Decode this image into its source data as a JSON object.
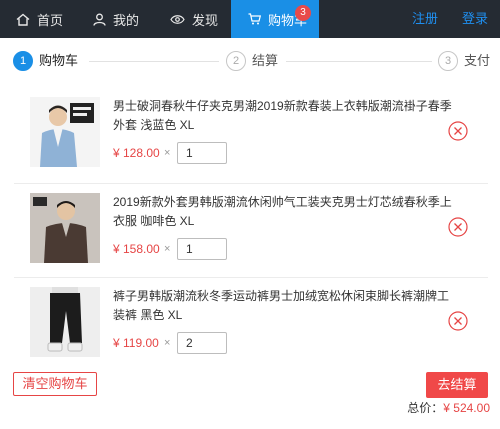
{
  "nav": {
    "home": "首页",
    "mine": "我的",
    "discover": "发现",
    "cart": "购物车",
    "cart_count": "3",
    "register": "注册",
    "login": "登录",
    "accent": "#1a8fe6",
    "bg": "#252b33"
  },
  "steps": [
    {
      "num": "1",
      "label": "购物车",
      "active": true
    },
    {
      "num": "2",
      "label": "结算",
      "active": false
    },
    {
      "num": "3",
      "label": "支付",
      "active": false
    }
  ],
  "items": [
    {
      "title": "男士破洞春秋牛仔夹克男潮2019新款春装上衣韩版潮流褂子春季外套 浅蓝色 XL",
      "price": "¥ 128.00",
      "times": "×",
      "qty": "1",
      "image": "denim-jacket-photo"
    },
    {
      "title": "2019新款外套男韩版潮流休闲帅气工装夹克男士灯芯绒春秋季上衣服 咖啡色 XL",
      "price": "¥ 158.00",
      "times": "×",
      "qty": "1",
      "image": "corduroy-jacket-photo"
    },
    {
      "title": "裤子男韩版潮流秋冬季运动裤男士加绒宽松休闲束脚长裤潮牌工装裤 黑色 XL",
      "price": "¥ 119.00",
      "times": "×",
      "qty": "2",
      "image": "jogger-pants-photo"
    }
  ],
  "footer": {
    "clear": "清空购物车",
    "checkout": "去结算",
    "total_label": "总价：",
    "total_value": "¥ 524.00",
    "danger": "#e64545"
  }
}
